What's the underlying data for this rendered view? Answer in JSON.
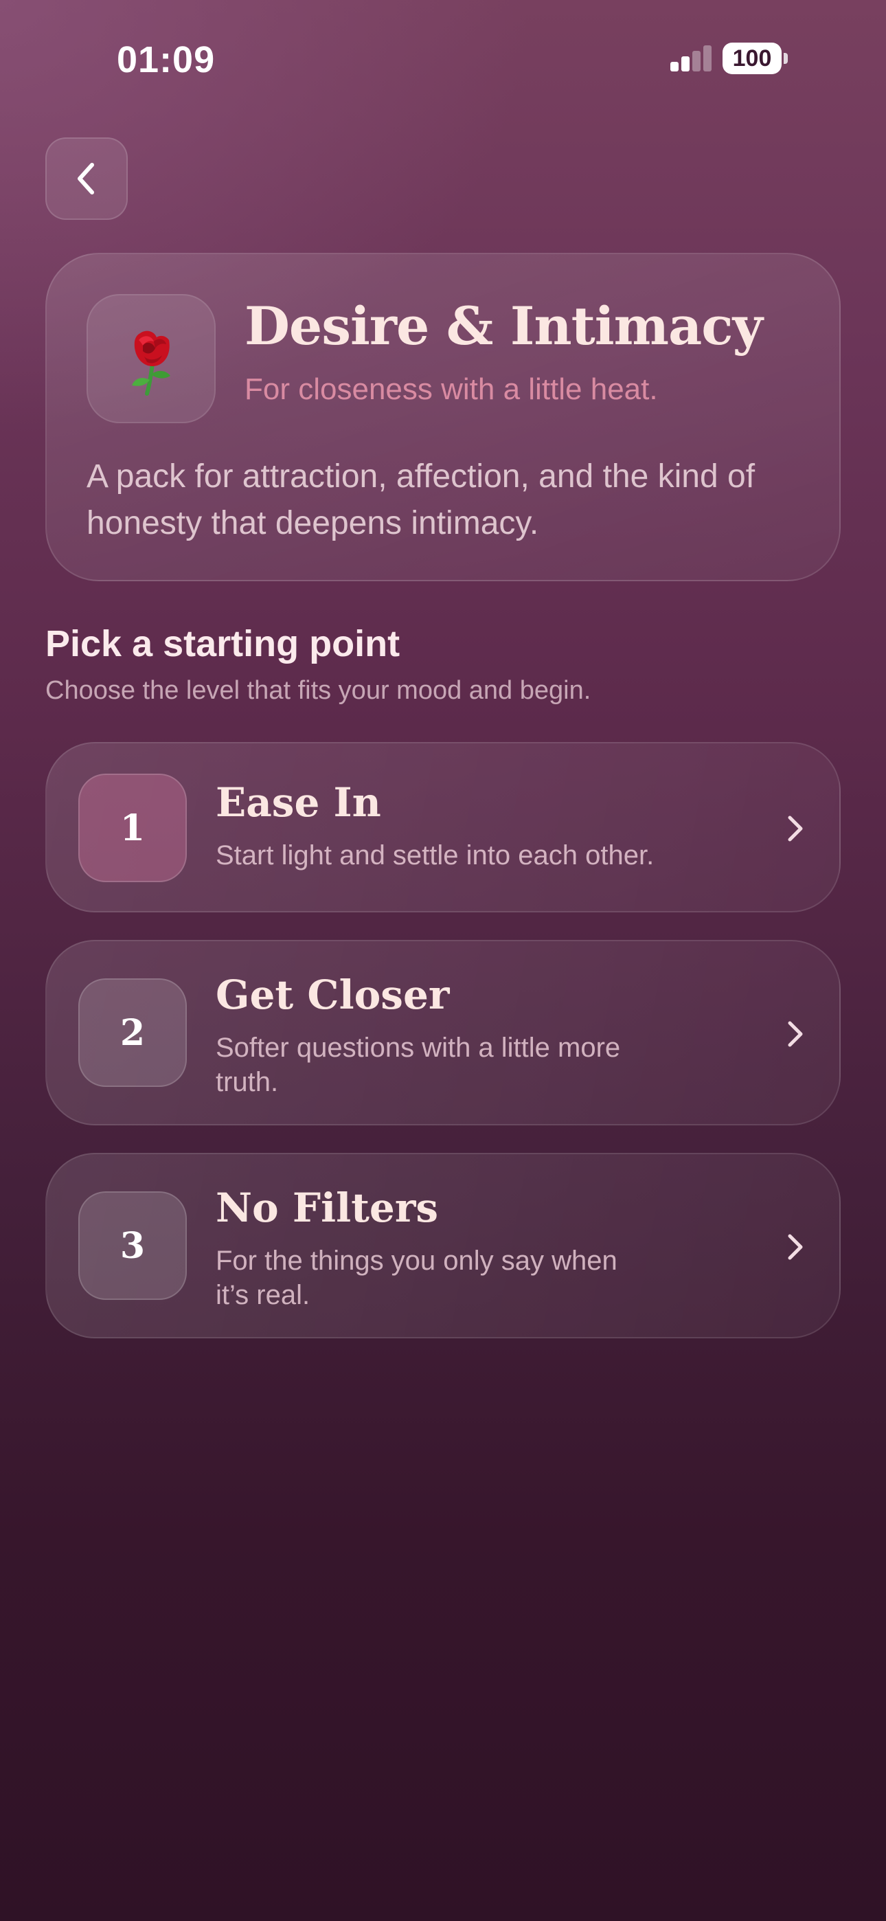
{
  "status_bar": {
    "time": "01:09",
    "battery": "100"
  },
  "nav": {
    "back_icon": "chevron-left-icon"
  },
  "pack": {
    "emoji": "🌹",
    "title": "Desire & Intimacy",
    "subtitle": "For closeness with a little heat.",
    "description": "A pack for attraction, affection, and the kind of honesty that deepens intimacy."
  },
  "section": {
    "title": "Pick a starting point",
    "subtitle": "Choose the level that fits your mood and begin."
  },
  "levels": [
    {
      "number": "1",
      "title": "Ease In",
      "description": "Start light and settle into each other."
    },
    {
      "number": "2",
      "title": "Get Closer",
      "description": "Softer questions with a little more truth."
    },
    {
      "number": "3",
      "title": "No Filters",
      "description": "For the things you only say when it’s real."
    }
  ],
  "colors": {
    "background_top": "#78405f",
    "background_bottom": "#2f1226",
    "title_text": "#fbe7e2",
    "accent_pink": "#d98ba2"
  }
}
